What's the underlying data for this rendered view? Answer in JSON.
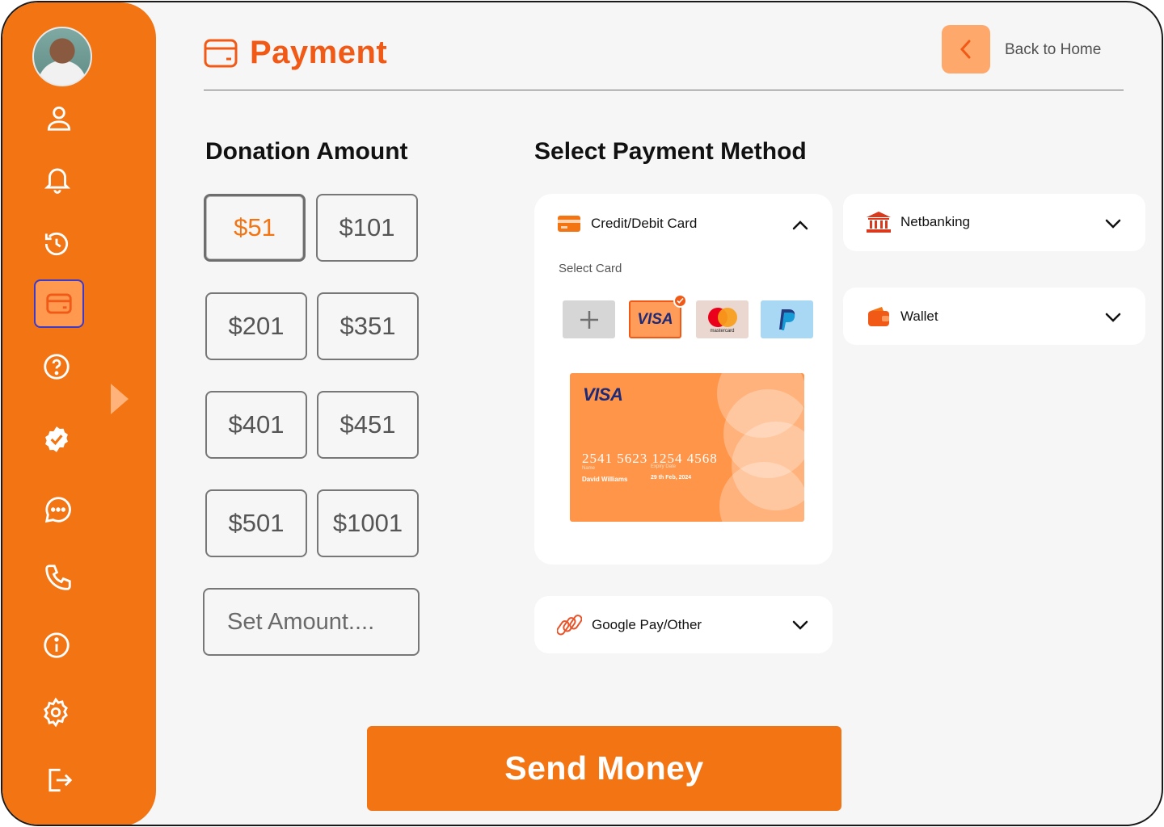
{
  "header": {
    "title": "Payment",
    "back_label": "Back to Home",
    "icon": "card-icon"
  },
  "sidebar": {
    "items": [
      {
        "name": "profile",
        "icon": "user-icon"
      },
      {
        "name": "notifications",
        "icon": "bell-icon"
      },
      {
        "name": "history",
        "icon": "history-icon"
      },
      {
        "name": "payment",
        "icon": "wallet-card-icon",
        "active": true
      },
      {
        "name": "help",
        "icon": "question-icon"
      },
      {
        "name": "verified",
        "icon": "verified-badge-icon"
      },
      {
        "name": "messages",
        "icon": "chat-icon"
      },
      {
        "name": "call",
        "icon": "phone-icon"
      },
      {
        "name": "info",
        "icon": "info-icon"
      },
      {
        "name": "settings",
        "icon": "gear-icon"
      },
      {
        "name": "logout",
        "icon": "logout-icon"
      }
    ]
  },
  "donation": {
    "title": "Donation Amount",
    "amounts": [
      "$51",
      "$101",
      "$201",
      "$351",
      "$401",
      "$451",
      "$501",
      "$1001"
    ],
    "selected": "$51",
    "custom_placeholder": "Set Amount...."
  },
  "payment": {
    "title": "Select Payment Method",
    "methods": {
      "card": {
        "label": "Credit/Debit Card",
        "expanded": true
      },
      "netbanking": {
        "label": "Netbanking",
        "expanded": false
      },
      "wallet": {
        "label": "Wallet",
        "expanded": false
      },
      "gpay": {
        "label": "Google Pay/Other",
        "expanded": false
      }
    },
    "select_card_label": "Select Card",
    "card_options": [
      "add",
      "VISA",
      "mastercard",
      "PayPal"
    ],
    "selected_card": "VISA",
    "card": {
      "brand": "VISA",
      "number": "2541 5623 1254 4568",
      "name_label": "Name",
      "expiry_label": "Expiry Date",
      "holder": "David Williams",
      "expiry": "29 th Feb, 2024"
    }
  },
  "send_button": "Send Money",
  "colors": {
    "primary": "#f37413",
    "accent": "#f15a16",
    "background": "#f6f6f6"
  }
}
